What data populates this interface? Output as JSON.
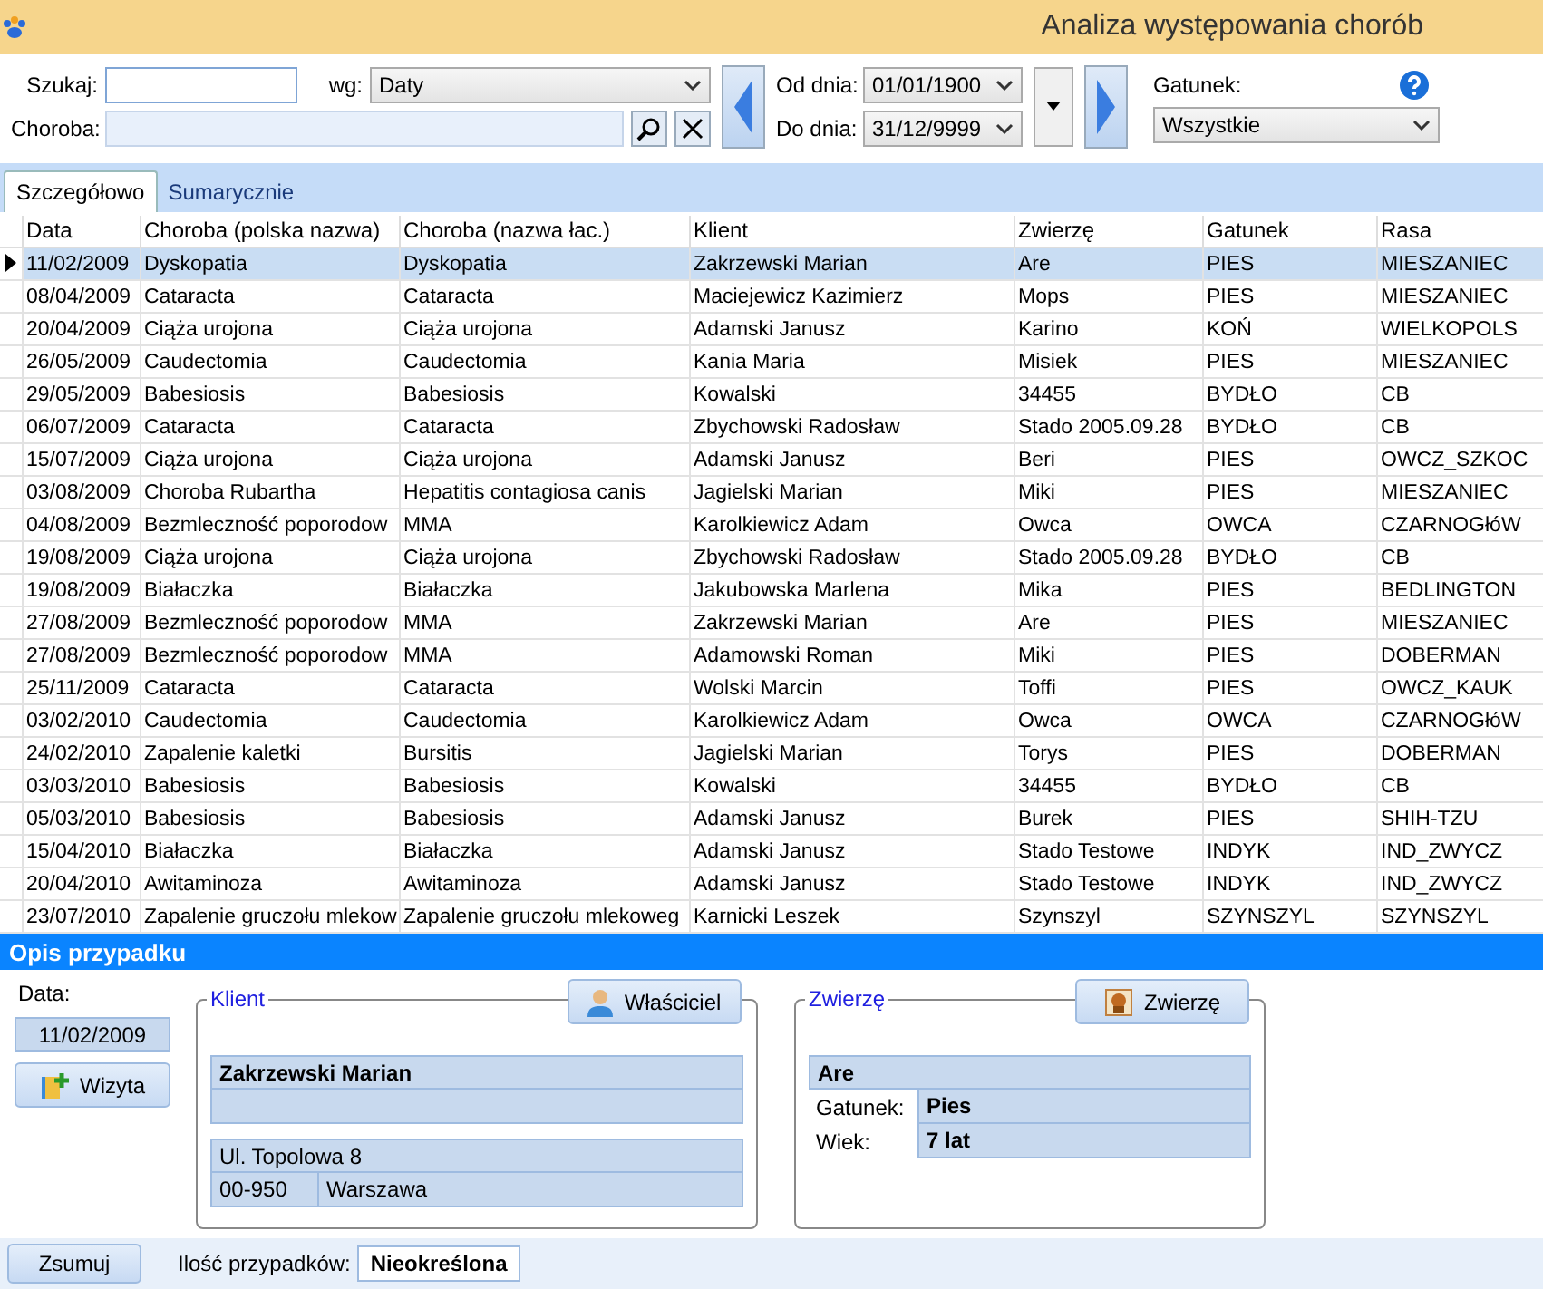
{
  "window": {
    "title": "Analiza występowania chorób"
  },
  "filters": {
    "search_label": "Szukaj:",
    "by_label": "wg:",
    "by_value": "Daty",
    "disease_label": "Choroba:",
    "from_label": "Od dnia:",
    "from_value": "01/01/1900",
    "to_label": "Do dnia:",
    "to_value": "31/12/9999",
    "species_label": "Gatunek:",
    "species_value": "Wszystkie"
  },
  "tabs": [
    {
      "label": "Szczegółowo",
      "selected": true
    },
    {
      "label": "Sumarycznie",
      "selected": false
    }
  ],
  "table": {
    "columns": [
      "Data",
      "Choroba (polska nazwa)",
      "Choroba (nazwa łac.)",
      "Klient",
      "Zwierzę",
      "Gatunek",
      "Rasa"
    ],
    "rows": [
      {
        "selected": true,
        "cells": [
          "11/02/2009",
          "Dyskopatia",
          "Dyskopatia",
          "Zakrzewski Marian",
          "Are",
          "PIES",
          "MIESZANIEC"
        ]
      },
      {
        "selected": false,
        "cells": [
          "08/04/2009",
          "Cataracta",
          "Cataracta",
          "Maciejewicz Kazimierz",
          "Mops",
          "PIES",
          "MIESZANIEC"
        ]
      },
      {
        "selected": false,
        "cells": [
          "20/04/2009",
          "Ciąża urojona",
          "Ciąża urojona",
          "Adamski Janusz",
          "Karino",
          "KOŃ",
          "WIELKOPOLS"
        ]
      },
      {
        "selected": false,
        "cells": [
          "26/05/2009",
          "Caudectomia",
          "Caudectomia",
          "Kania Maria",
          "Misiek",
          "PIES",
          "MIESZANIEC"
        ]
      },
      {
        "selected": false,
        "cells": [
          "29/05/2009",
          "Babesiosis",
          "Babesiosis",
          "Kowalski",
          "34455",
          "BYDŁO",
          "CB"
        ]
      },
      {
        "selected": false,
        "cells": [
          "06/07/2009",
          "Cataracta",
          "Cataracta",
          "Zbychowski Radosław",
          "Stado 2005.09.28",
          "BYDŁO",
          "CB"
        ]
      },
      {
        "selected": false,
        "cells": [
          "15/07/2009",
          "Ciąża urojona",
          "Ciąża urojona",
          "Adamski Janusz",
          "Beri",
          "PIES",
          "OWCZ_SZKOC"
        ]
      },
      {
        "selected": false,
        "cells": [
          "03/08/2009",
          "Choroba Rubartha",
          "Hepatitis contagiosa canis",
          "Jagielski Marian",
          "Miki",
          "PIES",
          "MIESZANIEC"
        ]
      },
      {
        "selected": false,
        "cells": [
          "04/08/2009",
          "Bezmleczność poporodow",
          "MMA",
          "Karolkiewicz Adam",
          "Owca",
          "OWCA",
          "CZARNOGłóW"
        ]
      },
      {
        "selected": false,
        "cells": [
          "19/08/2009",
          "Ciąża urojona",
          "Ciąża urojona",
          "Zbychowski Radosław",
          "Stado 2005.09.28",
          "BYDŁO",
          "CB"
        ]
      },
      {
        "selected": false,
        "cells": [
          "19/08/2009",
          "Białaczka",
          "Białaczka",
          "Jakubowska Marlena",
          "Mika",
          "PIES",
          "BEDLINGTON"
        ]
      },
      {
        "selected": false,
        "cells": [
          "27/08/2009",
          "Bezmleczność poporodow",
          "MMA",
          "Zakrzewski Marian",
          "Are",
          "PIES",
          "MIESZANIEC"
        ]
      },
      {
        "selected": false,
        "cells": [
          "27/08/2009",
          "Bezmleczność poporodow",
          "MMA",
          "Adamowski Roman",
          "Miki",
          "PIES",
          "DOBERMAN"
        ]
      },
      {
        "selected": false,
        "cells": [
          "25/11/2009",
          "Cataracta",
          "Cataracta",
          "Wolski Marcin",
          "Toffi",
          "PIES",
          "OWCZ_KAUK"
        ]
      },
      {
        "selected": false,
        "cells": [
          "03/02/2010",
          "Caudectomia",
          "Caudectomia",
          "Karolkiewicz Adam",
          "Owca",
          "OWCA",
          "CZARNOGłóW"
        ]
      },
      {
        "selected": false,
        "cells": [
          "24/02/2010",
          "Zapalenie kaletki",
          "Bursitis",
          "Jagielski Marian",
          "Torys",
          "PIES",
          "DOBERMAN"
        ]
      },
      {
        "selected": false,
        "cells": [
          "03/03/2010",
          "Babesiosis",
          "Babesiosis",
          "Kowalski",
          "34455",
          "BYDŁO",
          "CB"
        ]
      },
      {
        "selected": false,
        "cells": [
          "05/03/2010",
          "Babesiosis",
          "Babesiosis",
          "Adamski Janusz",
          "Burek",
          "PIES",
          "SHIH-TZU"
        ]
      },
      {
        "selected": false,
        "cells": [
          "15/04/2010",
          "Białaczka",
          "Białaczka",
          "Adamski Janusz",
          "Stado Testowe",
          "INDYK",
          "IND_ZWYCZ"
        ]
      },
      {
        "selected": false,
        "cells": [
          "20/04/2010",
          "Awitaminoza",
          "Awitaminoza",
          "Adamski Janusz",
          "Stado Testowe",
          "INDYK",
          "IND_ZWYCZ"
        ]
      },
      {
        "selected": false,
        "cells": [
          "23/07/2010",
          "Zapalenie gruczołu mlekow",
          "Zapalenie gruczołu mlekoweg",
          "Karnicki Leszek",
          "Szynszyl",
          "SZYNSZYL",
          "SZYNSZYL"
        ]
      }
    ]
  },
  "details": {
    "title": "Opis przypadku",
    "date_label": "Data:",
    "date_value": "11/02/2009",
    "visit_button": "Wizyta",
    "client": {
      "legend": "Klient",
      "button": "Właściciel",
      "name": "Zakrzewski Marian",
      "street": "Ul. Topolowa 8",
      "postcode": "00-950",
      "city": "Warszawa"
    },
    "animal": {
      "legend": "Zwierzę",
      "button": "Zwierzę",
      "name": "Are",
      "species_label": "Gatunek:",
      "species_value": "Pies",
      "age_label": "Wiek:",
      "age_value": "7 lat"
    }
  },
  "footer": {
    "sum_button": "Zsumuj",
    "count_label": "Ilość przypadków:",
    "count_value": "Nieokreślona"
  }
}
